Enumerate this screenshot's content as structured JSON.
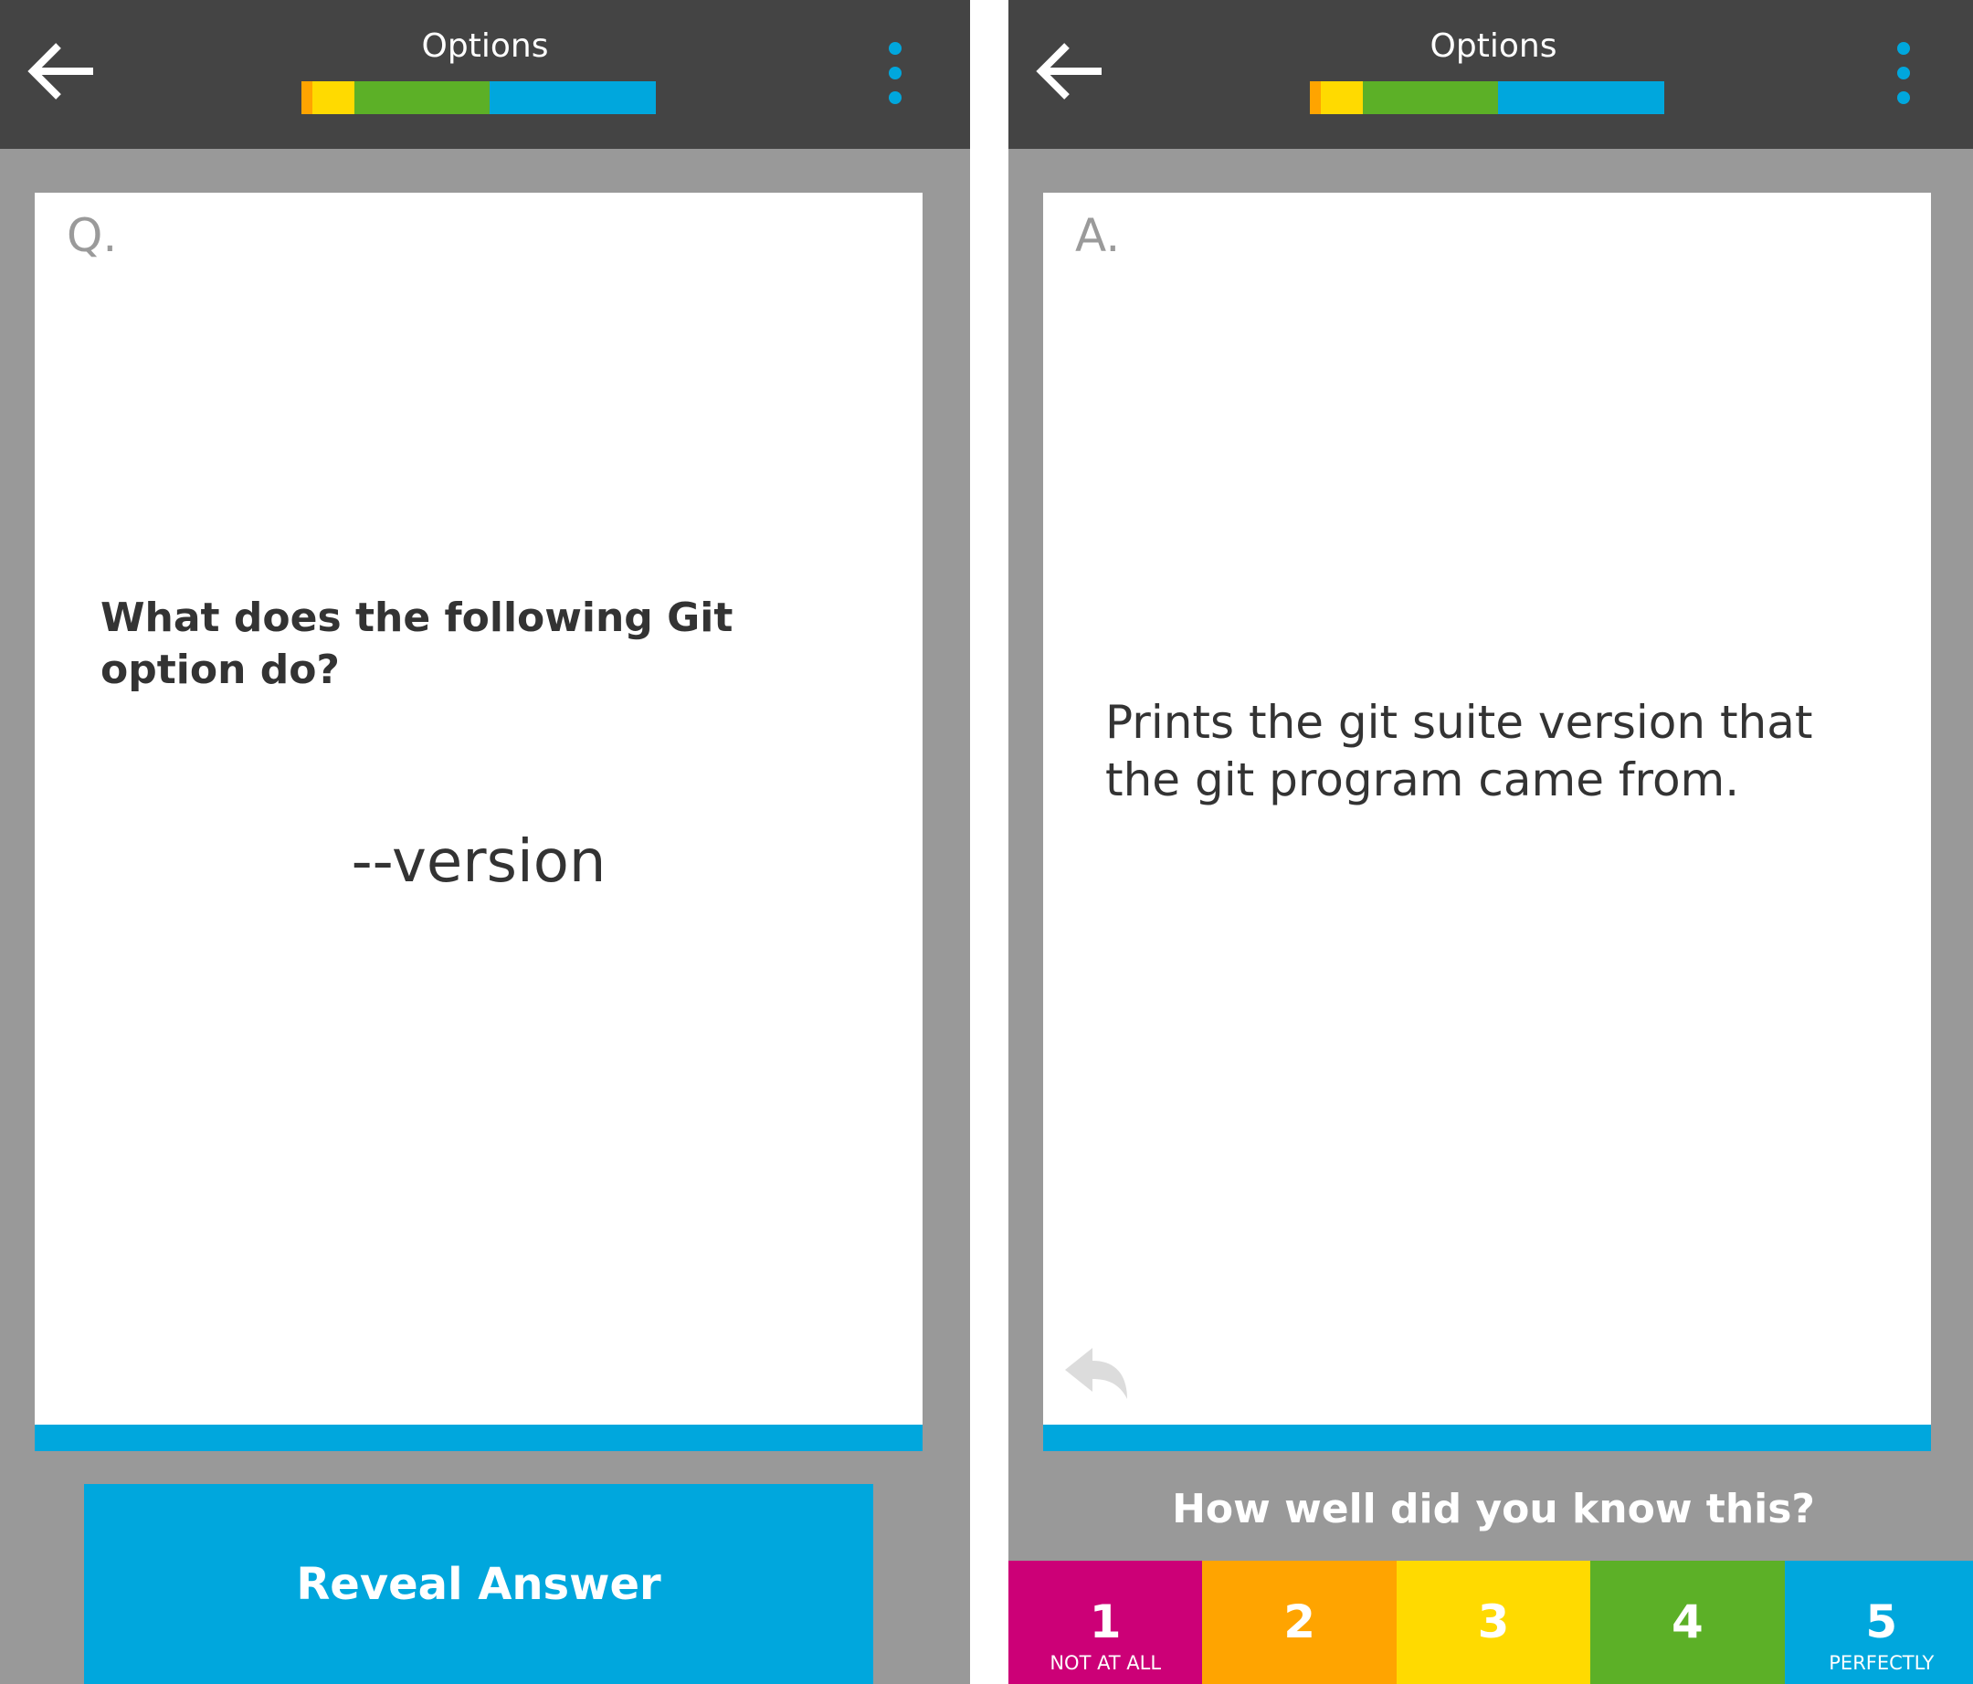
{
  "screens": {
    "question": {
      "title": "Options",
      "card_letter": "Q.",
      "question": "What does the following Git option do?",
      "option": "--version",
      "reveal_label": "Reveal Answer"
    },
    "answer": {
      "title": "Options",
      "card_letter": "A.",
      "answer": "Prints the git suite version that the git program came from.",
      "prompt": "How well did you know this?",
      "ratings": [
        {
          "number": "1",
          "caption": "NOT AT ALL",
          "color": "#cc0077"
        },
        {
          "number": "2",
          "caption": "",
          "color": "#ffa400"
        },
        {
          "number": "3",
          "caption": "",
          "color": "#ffda00"
        },
        {
          "number": "4",
          "caption": "",
          "color": "#5cb027"
        },
        {
          "number": "5",
          "caption": "PERFECTLY",
          "color": "#00a7dd"
        }
      ]
    }
  },
  "progress_segments": [
    {
      "color": "#ffa400",
      "fraction": 0.03
    },
    {
      "color": "#ffda00",
      "fraction": 0.12
    },
    {
      "color": "#5cb027",
      "fraction": 0.38
    },
    {
      "color": "#00a7dd",
      "fraction": 0.47
    }
  ],
  "icons": {
    "back": "back-arrow-icon",
    "menu": "overflow-menu-icon",
    "undo": "undo-icon"
  },
  "colors": {
    "header": "#444444",
    "background": "#999999",
    "accent": "#00a7dd"
  }
}
